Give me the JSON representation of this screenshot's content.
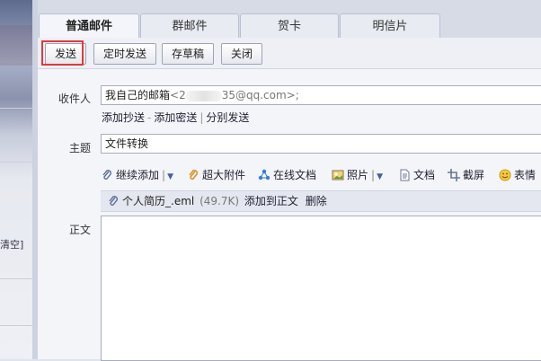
{
  "tabs": [
    {
      "label": "普通邮件",
      "active": true
    },
    {
      "label": "群邮件",
      "active": false
    },
    {
      "label": "贺卡",
      "active": false
    },
    {
      "label": "明信片",
      "active": false
    }
  ],
  "toolbar": {
    "send": "发送",
    "scheduled_send": "定时发送",
    "save_draft": "存草稿",
    "close": "关闭"
  },
  "recipient": {
    "label": "收件人",
    "value_prefix": "我自己的邮箱",
    "value_email_start": "<2",
    "value_email_end": "35@qq.com>;",
    "links": {
      "add_cc": "添加抄送",
      "sep": "-",
      "add_bcc": "添加密送",
      "bar": "|",
      "separate_send": "分别发送"
    }
  },
  "subject": {
    "label": "主题",
    "value": "文件转换"
  },
  "editor_tools": [
    {
      "label": "继续添加",
      "icon": "paperclip-icon"
    },
    {
      "label": "超大附件",
      "icon": "large-attachment-icon"
    },
    {
      "label": "在线文档",
      "icon": "online-doc-icon"
    },
    {
      "label": "照片",
      "icon": "photo-icon"
    },
    {
      "label": "文档",
      "icon": "document-icon"
    },
    {
      "label": "截屏",
      "icon": "screenshot-icon"
    },
    {
      "label": "表情",
      "icon": "emoji-icon"
    }
  ],
  "attachment": {
    "name": "个人简历_.eml",
    "size": "(49.7K)",
    "add_to_body": "添加到正文",
    "delete": "删除"
  },
  "body": {
    "label": "正文"
  },
  "sidebar": {
    "clear_text": "清空]"
  },
  "colors": {
    "accent_red": "#e03a3a",
    "link_blue": "#223"
  }
}
